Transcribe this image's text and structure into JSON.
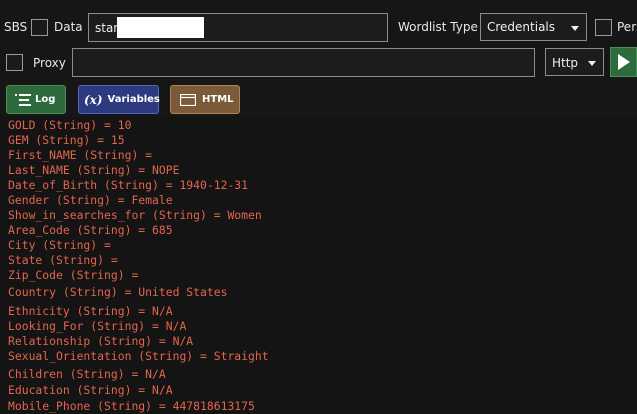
{
  "toolbar": {
    "sbs_label": "SBS",
    "data_label": "Data",
    "data_input_value": "star",
    "wordlist_type_label": "Wordlist Type",
    "wordlist_type_value": "Credentials",
    "pers_label": "Pers",
    "proxy_label": "Proxy",
    "proxy_input_value": "",
    "proxy_type_value": "Http"
  },
  "tabs": {
    "log_label": "Log",
    "variables_label": "Variables",
    "html_label": "HTML"
  },
  "log": [
    "GOLD (String) = 10",
    "GEM (String) = 15",
    "First_NAME (String) =",
    "Last_NAME (String) = NOPE",
    "Date_of_Birth (String) = 1940-12-31",
    "Gender (String) = Female",
    "Show_in_searches_for (String) = Women",
    "Area_Code (String) = 685",
    "City (String) =",
    "State (String) =",
    "Zip_Code (String) =",
    "Country (String) = United States",
    "Ethnicity (String) = N/A",
    "Looking_For (String) = N/A",
    "Relationship (String) = N/A",
    "Sexual_Orientation (String) = Straight",
    "Children (String) = N/A",
    "Education (String) = N/A",
    "Mobile_Phone (String) = 447818613175"
  ],
  "colors": {
    "log_text": "#e3654e",
    "log_tab": "#2e6b3c",
    "variables_tab": "#2e3a80",
    "html_tab": "#7a5a38",
    "start_button": "#2e6b3c"
  }
}
